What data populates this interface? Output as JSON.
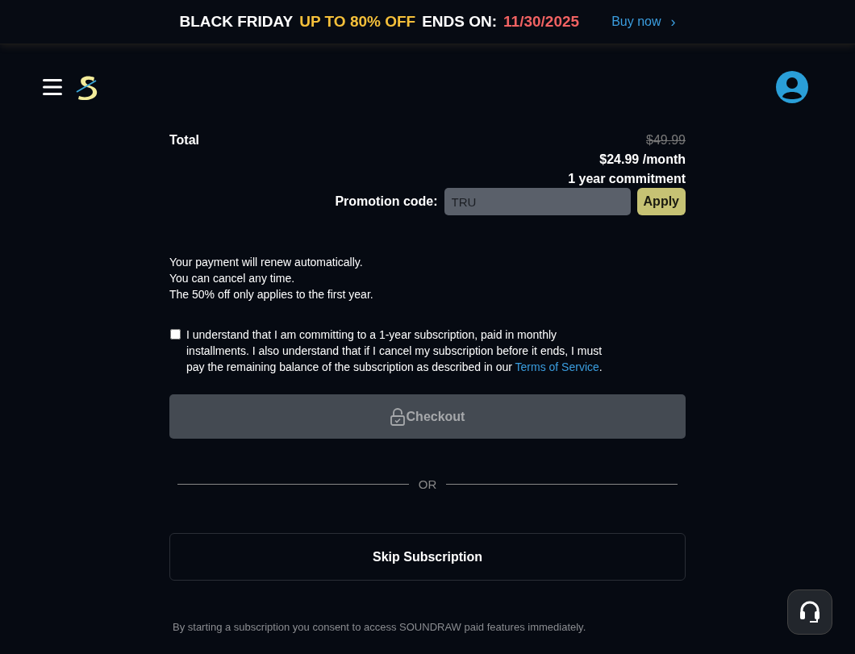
{
  "banner": {
    "title": "BLACK FRIDAY",
    "offer": "UP TO 80% OFF",
    "ends_label": "ENDS ON:",
    "date": "11/30/2025",
    "link": "Buy now",
    "link_icon": "›"
  },
  "summary": {
    "label": "Total",
    "old_price": "$49.99",
    "price": "$24.99 /month",
    "commitment": "1 year commitment"
  },
  "promo": {
    "label": "Promotion code:",
    "placeholder": "TRU",
    "button": "Apply"
  },
  "notes": [
    "Your payment will renew automatically.",
    "You can cancel any time.",
    "The 50% off only applies to the first year."
  ],
  "agreement": {
    "checked": false,
    "text": "I understand that I am committing to a 1-year subscription, paid in monthly installments. I also understand that if I cancel my subscription before it ends, I must pay the remaining balance of the subscription as described in our",
    "link": "Terms of Service",
    "end": "."
  },
  "checkout": {
    "label": "Checkout",
    "disabled": true
  },
  "divider": "OR",
  "skip": "Skip Subscription",
  "footer": "By starting a subscription you consent to access SOUNDRAW paid features immediately."
}
